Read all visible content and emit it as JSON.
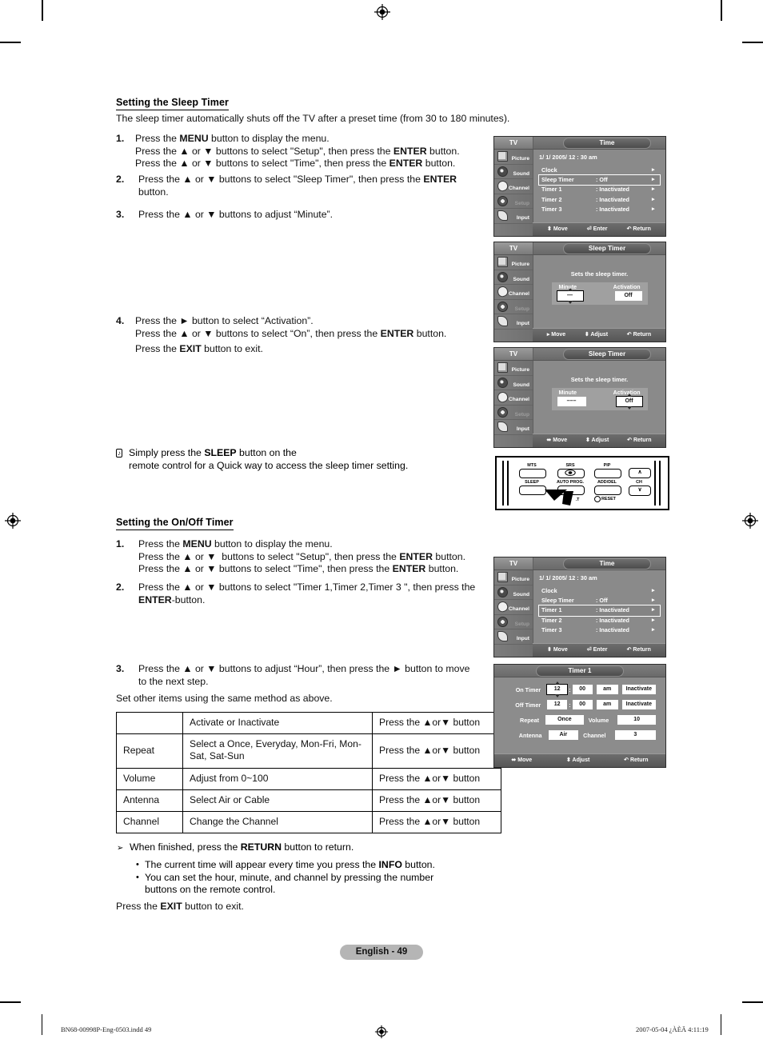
{
  "document": {
    "page_label": "English - 49",
    "footer_left": "BN68-00998P-Eng-0503.indd   49",
    "footer_right": "2007-05-04   ¿ÀÈÄ 4:11:19"
  },
  "section1": {
    "heading": "Setting the Sleep Timer",
    "intro": "The sleep timer automatically shuts off the TV after a preset time (from 30 to 180 minutes).",
    "steps": [
      {
        "num": "1.",
        "lines": [
          "Press the MENU button to display the menu.",
          "Press the ▲ or ▼ buttons to select \"Setup\", then press the ENTER button.",
          "Press the ▲ or ▼ buttons to select \"Time\", then press the ENTER button."
        ]
      },
      {
        "num": "2.",
        "lines": [
          "Press the ▲ or ▼ buttons to select \"Sleep Timer\", then press the ENTER button."
        ]
      },
      {
        "num": "3.",
        "lines": [
          "Press the ▲ or ▼ buttons to adjust “Minute”."
        ]
      },
      {
        "num": "4.",
        "lines": [
          "Press the ► button to select “Activation”.",
          "Press the ▲ or ▼ buttons to select “On”, then press the ENTER button."
        ]
      }
    ],
    "exit_line": "Press the EXIT button to exit.",
    "tip": {
      "glyph": "♪",
      "line1": "Simply press the SLEEP button on the",
      "line2": "remote control for a Quick way to access the sleep timer setting."
    }
  },
  "section2": {
    "heading": "Setting the On/Off Timer",
    "steps": [
      {
        "num": "1.",
        "lines": [
          "Press the MENU button to display the menu.",
          "Press the ▲ or ▼  buttons to select \"Setup\", then press the ENTER button.",
          "Press the ▲ or ▼ buttons to select \"Time\", then press the ENTER button."
        ]
      },
      {
        "num": "2.",
        "lines": [
          "Press the ▲ or ▼ buttons to select \"Timer 1,Timer 2,Timer 3 \", then press the",
          "ENTER-button."
        ]
      },
      {
        "num": "3.",
        "lines": [
          "Press the ▲ or ▼ buttons to adjust “Hour”, then press the ► button to move",
          "to the next step."
        ]
      }
    ],
    "after_steps": "Set other items using the same method as above.",
    "note": {
      "glyph": "➢",
      "text": "When finished, press the RETURN button to return."
    },
    "bullets": [
      "The current time will appear every time you press the INFO button.",
      "You can set the hour, minute, and channel by pressing the number",
      "buttons on the remote control."
    ],
    "exit_line": "Press the EXIT button to exit."
  },
  "table": {
    "rows": [
      {
        "c1": "",
        "c2": "Activate or Inactivate",
        "c3": "Press the ▲or▼ button"
      },
      {
        "c1": "Repeat",
        "c2": "Select a Once, Everyday, Mon-Fri, Mon-Sat, Sat-Sun",
        "c3": "Press the ▲or▼ button"
      },
      {
        "c1": "Volume",
        "c2": "Adjust from 0~100",
        "c3": "Press the ▲or▼ button"
      },
      {
        "c1": "Antenna",
        "c2": "Select Air or Cable",
        "c3": "Press the ▲or▼ button"
      },
      {
        "c1": "Channel",
        "c2": "Change the Channel",
        "c3": "Press the ▲or▼ button"
      }
    ]
  },
  "osd_common": {
    "tv_label": "TV",
    "rail": [
      {
        "label": "Picture",
        "icon": "picture-icon"
      },
      {
        "label": "Sound",
        "icon": "sound-icon"
      },
      {
        "label": "Channel",
        "icon": "channel-icon"
      },
      {
        "label": "Setup",
        "icon": "setup-icon"
      },
      {
        "label": "Input",
        "icon": "input-icon"
      }
    ]
  },
  "osd_time_1": {
    "title": "Time",
    "datetime": "1/ 1/ 2005/ 12 : 30 am",
    "rows": [
      {
        "label": "Clock",
        "value": "",
        "arrow": "►",
        "selected": false
      },
      {
        "label": "Sleep Timer",
        "value": ": Off",
        "arrow": "►",
        "selected": true
      },
      {
        "label": "Timer 1",
        "value": ": Inactivated",
        "arrow": "►",
        "selected": false
      },
      {
        "label": "Timer 2",
        "value": ": Inactivated",
        "arrow": "►",
        "selected": false
      },
      {
        "label": "Timer 3",
        "value": ": Inactivated",
        "arrow": "►",
        "selected": false
      }
    ],
    "footer": [
      "⬍ Move",
      "⏎ Enter",
      "↶ Return"
    ]
  },
  "osd_sleep_1": {
    "title": "Sleep Timer",
    "hint": "Sets the sleep timer.",
    "col_minute": "Minute",
    "col_activation": "Activation",
    "minute_value": "—",
    "activation_value": "Off",
    "focus": "minute",
    "footer": [
      "▸ Move",
      "⬍ Adjust",
      "↶ Return"
    ]
  },
  "osd_sleep_2": {
    "title": "Sleep Timer",
    "hint": "Sets the sleep timer.",
    "col_minute": "Minute",
    "col_activation": "Activation",
    "minute_value": "–––",
    "activation_value": "Off",
    "focus": "activation",
    "footer": [
      "⬌ Move",
      "⬍ Adjust",
      "↶ Return"
    ]
  },
  "osd_time_2": {
    "title": "Time",
    "datetime": "1/ 1/ 2005/ 12 : 30 am",
    "rows": [
      {
        "label": "Clock",
        "value": "",
        "arrow": "►",
        "selected": false
      },
      {
        "label": "Sleep Timer",
        "value": ": Off",
        "arrow": "►",
        "selected": false
      },
      {
        "label": "Timer 1",
        "value": ": Inactivated",
        "arrow": "►",
        "selected": true
      },
      {
        "label": "Timer 2",
        "value": ": Inactivated",
        "arrow": "►",
        "selected": false
      },
      {
        "label": "Timer 3",
        "value": ": Inactivated",
        "arrow": "►",
        "selected": false
      }
    ],
    "footer": [
      "⬍ Move",
      "⏎ Enter",
      "↶ Return"
    ]
  },
  "osd_timer1": {
    "title": "Timer 1",
    "on_timer_label": "On Timer",
    "on_timer": {
      "hour": "12",
      "minute": "00",
      "ampm": "am",
      "activation": "Inactivate"
    },
    "off_timer_label": "Off Timer",
    "off_timer": {
      "hour": "12",
      "minute": "00",
      "ampm": "am",
      "activation": "Inactivate"
    },
    "repeat_label": "Repeat",
    "repeat_value": "Once",
    "volume_label": "Volume",
    "volume_value": "10",
    "antenna_label": "Antenna",
    "antenna_value": "Air",
    "channel_label": "Channel",
    "channel_value": "3",
    "footer": [
      "⬌ Move",
      "⬍ Adjust",
      "↶ Return"
    ]
  },
  "remote": {
    "buttons": [
      {
        "name": "mts-button",
        "label": "MTS"
      },
      {
        "name": "srs-button",
        "label": "SRS"
      },
      {
        "name": "pip-button",
        "label": "PIP"
      },
      {
        "name": "sleep-button",
        "label": "SLEEP"
      },
      {
        "name": "auto-prog-button",
        "label": "AUTO PROG."
      },
      {
        "name": "add-del-button",
        "label": "ADD/DEL"
      },
      {
        "name": "ch-label",
        "label": "CH"
      },
      {
        "name": "reset-button",
        "label": "RESET"
      },
      {
        "name": "partial-label",
        "label": ".T"
      }
    ],
    "ch_up": "∧",
    "ch_down": "∨"
  },
  "colors": {
    "osd_bg": "#8a8a8a",
    "osd_title_bg": "#5c5c5c",
    "badge_bg": "#b5b5b5",
    "text": "#111111"
  }
}
